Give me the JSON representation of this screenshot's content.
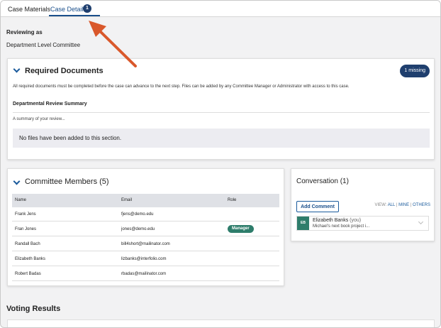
{
  "tabs": [
    {
      "label": "Case Materials"
    },
    {
      "label": "Case Details",
      "count": "1"
    }
  ],
  "reviewing": {
    "label": "Reviewing as",
    "committee": "Department Level Committee"
  },
  "required_documents": {
    "title": "Required Documents",
    "missing": "1 missing",
    "description": "All required documents must be completed before the case can advance to the next step. Files can be added by any Committee Manager or Administrator with access to this case.",
    "section_title": "Departmental Review Summary",
    "summary_placeholder": "A summary of your review...",
    "no_files": "No files have been added to this section."
  },
  "members": {
    "title": "Committee Members (5)",
    "headers": {
      "name": "Name",
      "email": "Email",
      "role": "Role"
    },
    "rows": [
      {
        "name": "Frank Jens",
        "email": "fjens@demo.edu",
        "role": ""
      },
      {
        "name": "Fran Jones",
        "email": "jones@demo.edu",
        "role": "Manager"
      },
      {
        "name": "Randall Bach",
        "email": "bill4short@mailinator.com",
        "role": ""
      },
      {
        "name": "Elizabeth Banks",
        "email": "lizbanks@interfolio.com",
        "role": ""
      },
      {
        "name": "Robert Badas",
        "email": "rbadas@mailinator.com",
        "role": ""
      }
    ]
  },
  "conversation": {
    "title": "Conversation (1)",
    "add_comment": "Add Comment",
    "view_label": "VIEW:",
    "view_all": "ALL",
    "view_mine": "MINE",
    "view_others": "OTHERS",
    "comment": {
      "initials": "EB",
      "author": "Elizabeth Banks",
      "you": "(you)",
      "preview": "Michael's next book project i..."
    }
  },
  "voting": {
    "title": "Voting Results"
  },
  "colors": {
    "accent": "#1a4f8b",
    "badge": "#1f3f6e",
    "manager": "#2e7d6b",
    "annotation_arrow": "#d9582b"
  }
}
